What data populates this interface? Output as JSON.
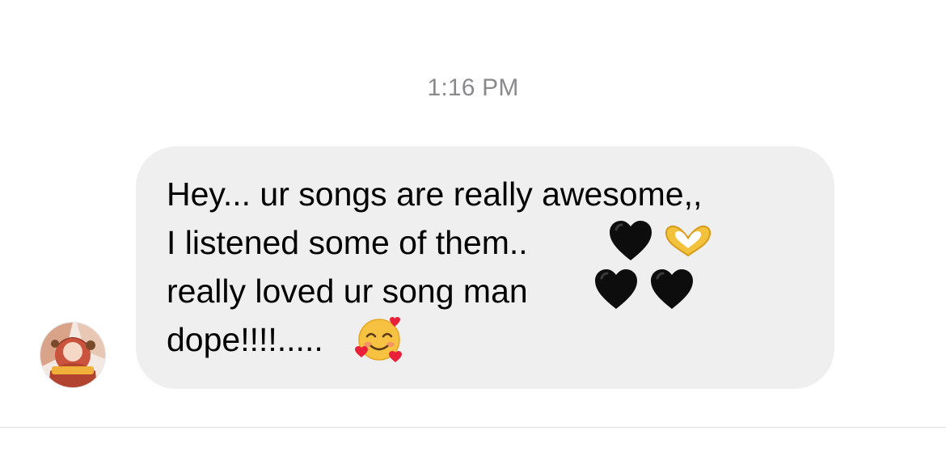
{
  "thread": {
    "timestamp": "1:16 PM"
  },
  "message": {
    "lines": [
      "Hey... ur songs are really awesome,,",
      "I listened some of them..",
      "really loved ur song man",
      "dope!!!!....."
    ],
    "emojis": [
      {
        "name": "black-heart-icon",
        "after_line": 2
      },
      {
        "name": "heart-hands-icon",
        "after_line": 2
      },
      {
        "name": "black-heart-icon",
        "after_line": 3
      },
      {
        "name": "black-heart-icon",
        "after_line": 3
      },
      {
        "name": "smiling-face-with-hearts-icon",
        "after_line": 4
      }
    ]
  },
  "colors": {
    "bubble": "#efefef",
    "timestamp": "#8a8a8e",
    "text": "#000000",
    "divider": "#dedede"
  }
}
